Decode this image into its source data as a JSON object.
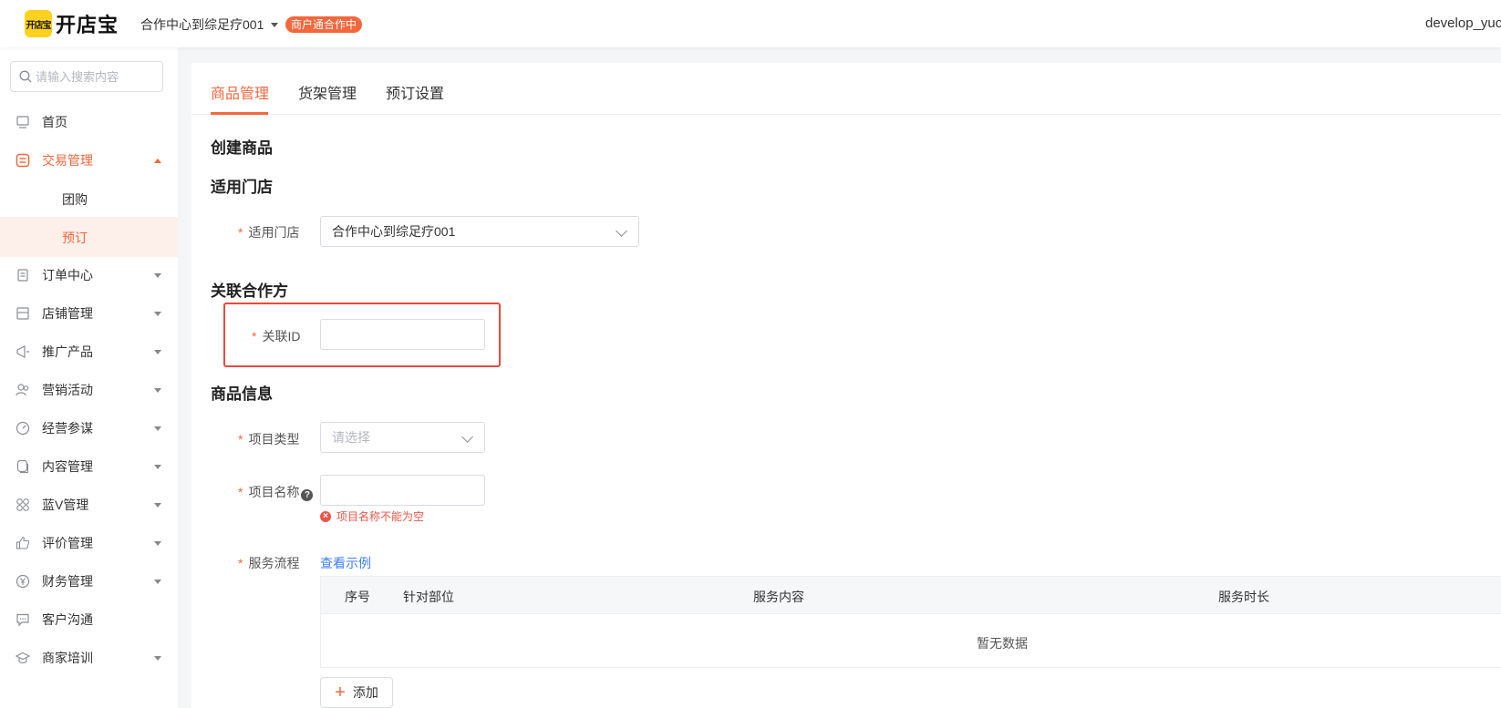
{
  "header": {
    "logo_badge": "开店宝",
    "logo_text": "开店宝",
    "store_name": "合作中心到综足疗001",
    "status_badge": "商户通合作中",
    "user_name": "develop_yuc"
  },
  "sidebar": {
    "search_placeholder": "请输入搜索内容",
    "items": [
      {
        "label": "首页"
      },
      {
        "label": "交易管理"
      },
      {
        "label": "订单中心"
      },
      {
        "label": "店铺管理"
      },
      {
        "label": "推广产品"
      },
      {
        "label": "营销活动"
      },
      {
        "label": "经营参谋"
      },
      {
        "label": "内容管理"
      },
      {
        "label": "蓝V管理"
      },
      {
        "label": "评价管理"
      },
      {
        "label": "财务管理"
      },
      {
        "label": "客户沟通"
      },
      {
        "label": "商家培训"
      }
    ],
    "sub_items": [
      {
        "label": "团购"
      },
      {
        "label": "预订"
      }
    ]
  },
  "tabs": [
    {
      "label": "商品管理"
    },
    {
      "label": "货架管理"
    },
    {
      "label": "预订设置"
    }
  ],
  "form": {
    "page_title": "创建商品",
    "section_store": "适用门店",
    "store_label": "适用门店",
    "store_value": "合作中心到综足疗001",
    "section_partner": "关联合作方",
    "partner_id_label": "关联ID",
    "partner_id_value": "",
    "section_product": "商品信息",
    "project_type_label": "项目类型",
    "project_type_placeholder": "请选择",
    "project_name_label": "项目名称",
    "project_name_value": "",
    "project_name_error": "项目名称不能为空",
    "service_flow_label": "服务流程",
    "view_example_link": "查看示例",
    "required_mark": "*"
  },
  "service_table": {
    "columns": [
      "序号",
      "针对部位",
      "服务内容",
      "服务时长"
    ],
    "empty_text": "暂无数据",
    "add_label": "添加"
  },
  "colors": {
    "accent": "#f5673c",
    "error": "#f0554a",
    "highlight_border": "#e84a3e",
    "link": "#3d7eff"
  }
}
